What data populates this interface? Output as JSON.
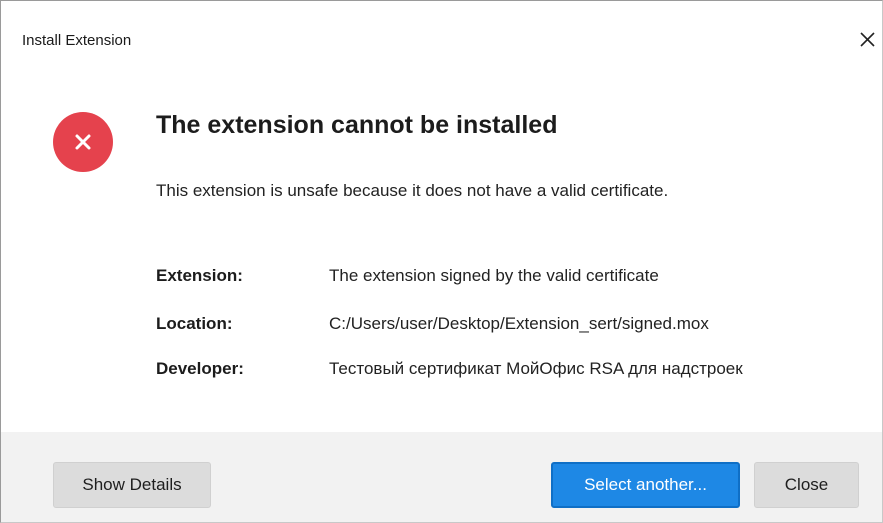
{
  "window": {
    "title": "Install Extension",
    "close_icon": "close-icon"
  },
  "error": {
    "icon": "error-circle-x-icon",
    "icon_color": "#e5424d",
    "heading": "The extension cannot be installed",
    "message": "This extension is unsafe because it does not have a valid certificate."
  },
  "details": [
    {
      "label": "Extension:",
      "value": "The extension signed by the valid certificate"
    },
    {
      "label": "Location:",
      "value": "C:/Users/user/Desktop/Extension_sert/signed.mox"
    },
    {
      "label": "Developer:",
      "value": "Тестовый сертификат МойОфис RSA для надстроек"
    }
  ],
  "footer": {
    "show_details_label": "Show Details",
    "select_another_label": "Select another...",
    "close_label": "Close",
    "primary_color": "#1e88e5"
  }
}
